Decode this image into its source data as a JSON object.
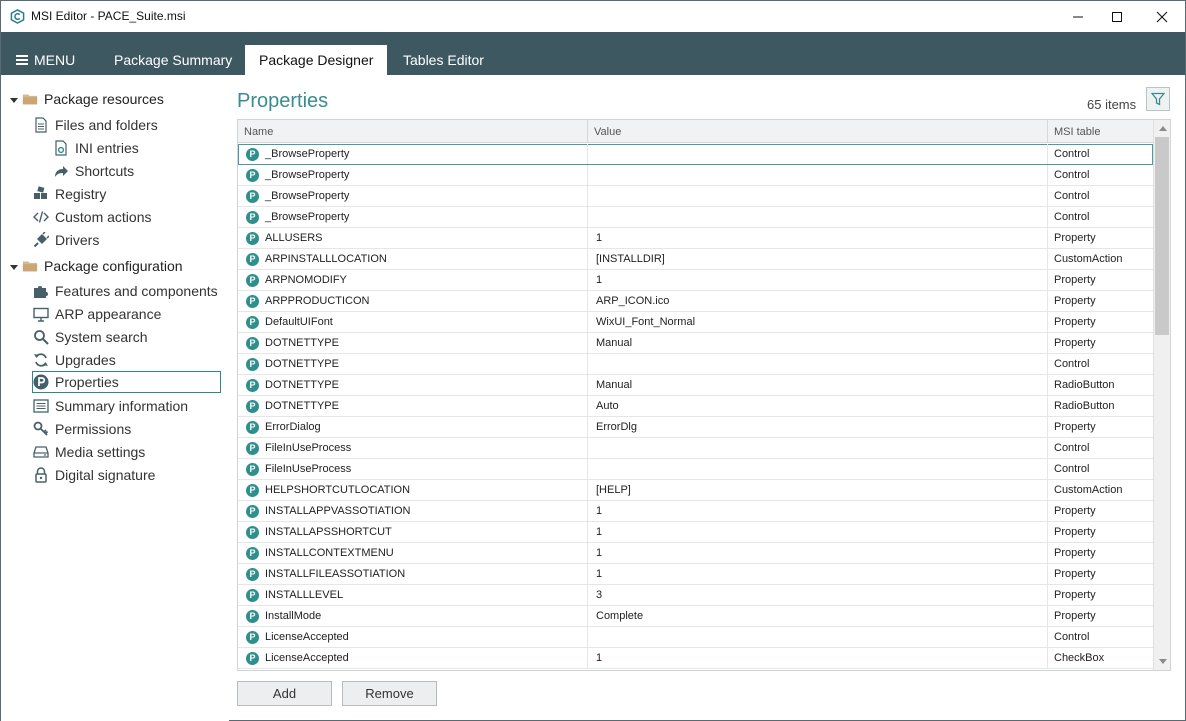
{
  "window": {
    "title": "MSI Editor - PACE_Suite.msi",
    "controls": [
      "minimize-icon",
      "maximize-icon",
      "close-icon"
    ]
  },
  "menubar": {
    "menu_label": "MENU",
    "tabs": [
      {
        "label": "Package Summary",
        "active": false
      },
      {
        "label": "Package Designer",
        "active": true
      },
      {
        "label": "Tables Editor",
        "active": false
      }
    ]
  },
  "sidebar": {
    "groups": [
      {
        "label": "Package resources",
        "items": [
          {
            "label": "Files and folders",
            "icon": "document-icon"
          },
          {
            "label": "INI entries",
            "icon": "ini-file-icon"
          },
          {
            "label": "Shortcuts",
            "icon": "shortcut-arrow-icon"
          },
          {
            "label": "Registry",
            "icon": "registry-icon"
          },
          {
            "label": "Custom actions",
            "icon": "code-icon"
          },
          {
            "label": "Drivers",
            "icon": "plug-icon"
          }
        ]
      },
      {
        "label": "Package configuration",
        "items": [
          {
            "label": "Features and components",
            "icon": "puzzle-icon"
          },
          {
            "label": "ARP appearance",
            "icon": "monitor-icon"
          },
          {
            "label": "System search",
            "icon": "search-icon"
          },
          {
            "label": "Upgrades",
            "icon": "refresh-icon"
          },
          {
            "label": "Properties",
            "icon": "property-icon"
          },
          {
            "label": "Summary information",
            "icon": "list-icon"
          },
          {
            "label": "Permissions",
            "icon": "key-icon"
          },
          {
            "label": "Media settings",
            "icon": "drive-icon"
          },
          {
            "label": "Digital signature",
            "icon": "lock-icon"
          }
        ]
      }
    ]
  },
  "main": {
    "title": "Properties",
    "items_count": "65 items",
    "columns": [
      "Name",
      "Value",
      "MSI table"
    ],
    "rows": [
      {
        "name": "_BrowseProperty",
        "value": "",
        "table": "Control"
      },
      {
        "name": "_BrowseProperty",
        "value": "",
        "table": "Control"
      },
      {
        "name": "_BrowseProperty",
        "value": "",
        "table": "Control"
      },
      {
        "name": "_BrowseProperty",
        "value": "",
        "table": "Control"
      },
      {
        "name": "ALLUSERS",
        "value": "1",
        "table": "Property"
      },
      {
        "name": "ARPINSTALLLOCATION",
        "value": "[INSTALLDIR]",
        "table": "CustomAction"
      },
      {
        "name": "ARPNOMODIFY",
        "value": "1",
        "table": "Property"
      },
      {
        "name": "ARPPRODUCTICON",
        "value": "ARP_ICON.ico",
        "table": "Property"
      },
      {
        "name": "DefaultUIFont",
        "value": "WixUI_Font_Normal",
        "table": "Property"
      },
      {
        "name": "DOTNETTYPE",
        "value": "Manual",
        "table": "Property"
      },
      {
        "name": "DOTNETTYPE",
        "value": "",
        "table": "Control"
      },
      {
        "name": "DOTNETTYPE",
        "value": "Manual",
        "table": "RadioButton"
      },
      {
        "name": "DOTNETTYPE",
        "value": "Auto",
        "table": "RadioButton"
      },
      {
        "name": "ErrorDialog",
        "value": "ErrorDlg",
        "table": "Property"
      },
      {
        "name": "FileInUseProcess",
        "value": "",
        "table": "Control"
      },
      {
        "name": "FileInUseProcess",
        "value": "",
        "table": "Control"
      },
      {
        "name": "HELPSHORTCUTLOCATION",
        "value": "[HELP]",
        "table": "CustomAction"
      },
      {
        "name": "INSTALLAPPVASSOTIATION",
        "value": "1",
        "table": "Property"
      },
      {
        "name": "INSTALLAPSSHORTCUT",
        "value": "1",
        "table": "Property"
      },
      {
        "name": "INSTALLCONTEXTMENU",
        "value": "1",
        "table": "Property"
      },
      {
        "name": "INSTALLFILEASSOTIATION",
        "value": "1",
        "table": "Property"
      },
      {
        "name": "INSTALLLEVEL",
        "value": "3",
        "table": "Property"
      },
      {
        "name": "InstallMode",
        "value": "Complete",
        "table": "Property"
      },
      {
        "name": "LicenseAccepted",
        "value": "",
        "table": "Control"
      },
      {
        "name": "LicenseAccepted",
        "value": "1",
        "table": "CheckBox"
      }
    ],
    "row_icon_letter": "P",
    "add_label": "Add",
    "remove_label": "Remove"
  },
  "colors": {
    "accent": "#3a8c91",
    "menubar": "#3e5862",
    "icon_teal": "#2f8f8c"
  }
}
